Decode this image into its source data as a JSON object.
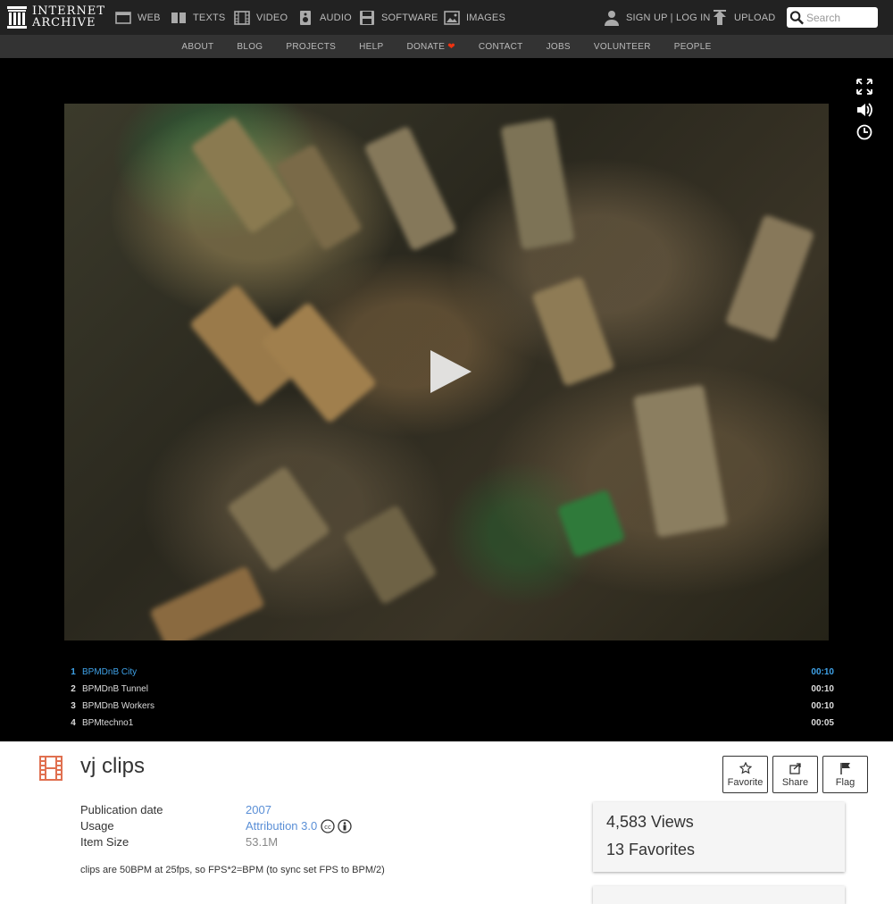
{
  "header": {
    "logo_line1": "INTERNET",
    "logo_line2": "ARCHIVE",
    "nav": [
      {
        "label": "WEB",
        "icon": "web-icon"
      },
      {
        "label": "TEXTS",
        "icon": "book-icon"
      },
      {
        "label": "VIDEO",
        "icon": "film-icon"
      },
      {
        "label": "AUDIO",
        "icon": "speaker-icon"
      },
      {
        "label": "SOFTWARE",
        "icon": "floppy-icon"
      },
      {
        "label": "IMAGES",
        "icon": "image-icon"
      }
    ],
    "account": "SIGN UP | LOG IN",
    "upload": "UPLOAD",
    "search_placeholder": "Search"
  },
  "subnav": [
    "ABOUT",
    "BLOG",
    "PROJECTS",
    "HELP",
    "DONATE",
    "CONTACT",
    "JOBS",
    "VOLUNTEER",
    "PEOPLE"
  ],
  "player": {
    "controls": [
      "fullscreen-icon",
      "volume-icon",
      "clock-icon"
    ],
    "playlist": [
      {
        "num": "1",
        "title": "BPMDnB City",
        "duration": "00:10",
        "active": true
      },
      {
        "num": "2",
        "title": "BPMDnB Tunnel",
        "duration": "00:10",
        "active": false
      },
      {
        "num": "3",
        "title": "BPMDnB Workers",
        "duration": "00:10",
        "active": false
      },
      {
        "num": "4",
        "title": "BPMtechno1",
        "duration": "00:05",
        "active": false
      }
    ]
  },
  "item": {
    "title": "vj clips",
    "actions": {
      "favorite": "Favorite",
      "share": "Share",
      "flag": "Flag"
    },
    "metadata": {
      "pub_label": "Publication date",
      "pub_value": "2007",
      "usage_label": "Usage",
      "usage_value": "Attribution 3.0",
      "size_label": "Item Size",
      "size_value": "53.1M"
    },
    "description": "clips are 50BPM at 25fps, so FPS*2=BPM (to sync set FPS to BPM/2)",
    "stats": {
      "views": "4,583 Views",
      "favorites": "13 Favorites"
    }
  },
  "colors": {
    "accent": "#3fa2e8",
    "link": "#5a8fd6",
    "film_icon": "#e07050",
    "donate_heart": "#ee3311"
  }
}
